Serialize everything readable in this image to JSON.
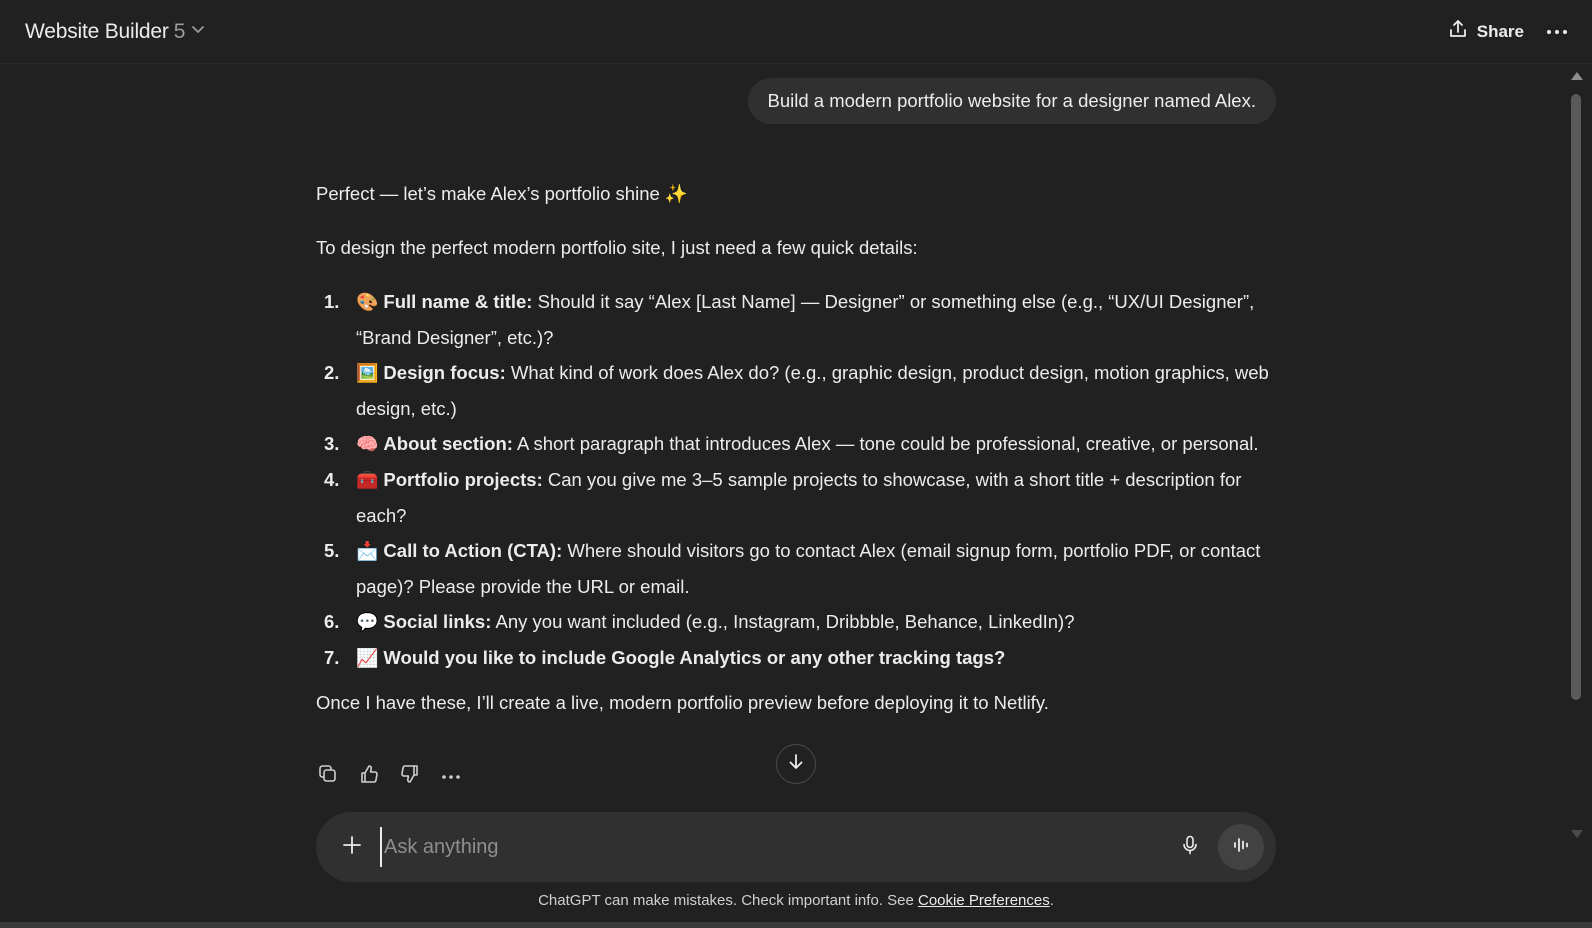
{
  "header": {
    "model_name": "Website Builder",
    "model_version": "5",
    "share_label": "Share"
  },
  "conversation": {
    "user_message": "Build a modern portfolio website for a designer named Alex.",
    "assistant": {
      "intro": "Perfect — let’s make Alex’s portfolio shine ✨",
      "lead": "To design the perfect modern portfolio site, I just need a few quick details:",
      "items": [
        {
          "num": "1.",
          "emoji": "🎨",
          "title": "Full name & title:",
          "text": " Should it say “Alex [Last Name] — Designer” or something else (e.g., “UX/UI Designer”, “Brand Designer”, etc.)?"
        },
        {
          "num": "2.",
          "emoji": "🖼️",
          "title": "Design focus:",
          "text": " What kind of work does Alex do? (e.g., graphic design, product design, motion graphics, web design, etc.)"
        },
        {
          "num": "3.",
          "emoji": "🧠",
          "title": "About section:",
          "text": " A short paragraph that introduces Alex — tone could be professional, creative, or personal."
        },
        {
          "num": "4.",
          "emoji": "🧰",
          "title": "Portfolio projects:",
          "text": " Can you give me 3–5 sample projects to showcase, with a short title + description for each?"
        },
        {
          "num": "5.",
          "emoji": "📩",
          "title": "Call to Action (CTA):",
          "text": " Where should visitors go to contact Alex (email signup form, portfolio PDF, or contact page)? Please provide the URL or email."
        },
        {
          "num": "6.",
          "emoji": "💬",
          "title": "Social links:",
          "text": " Any you want included (e.g., Instagram, Dribbble, Behance, LinkedIn)?"
        },
        {
          "num": "7.",
          "emoji": "📈",
          "title": "Would you like to include Google Analytics or any other tracking tags?",
          "text": ""
        }
      ],
      "outro": "Once I have these, I’ll create a live, modern portfolio preview before deploying it to Netlify."
    }
  },
  "composer": {
    "placeholder": "Ask anything"
  },
  "footer": {
    "text": "ChatGPT can make mistakes. Check important info. See ",
    "link": "Cookie Preferences",
    "suffix": "."
  },
  "icons": [
    "chevron-down-icon",
    "share-icon",
    "more-icon",
    "copy-icon",
    "thumbs-up-icon",
    "thumbs-down-icon",
    "arrow-down-icon",
    "plus-icon",
    "mic-icon",
    "voice-icon"
  ],
  "colors": {
    "background": "#212121",
    "bubble": "#303030",
    "text": "#ececec",
    "muted": "#9b9b9b"
  }
}
